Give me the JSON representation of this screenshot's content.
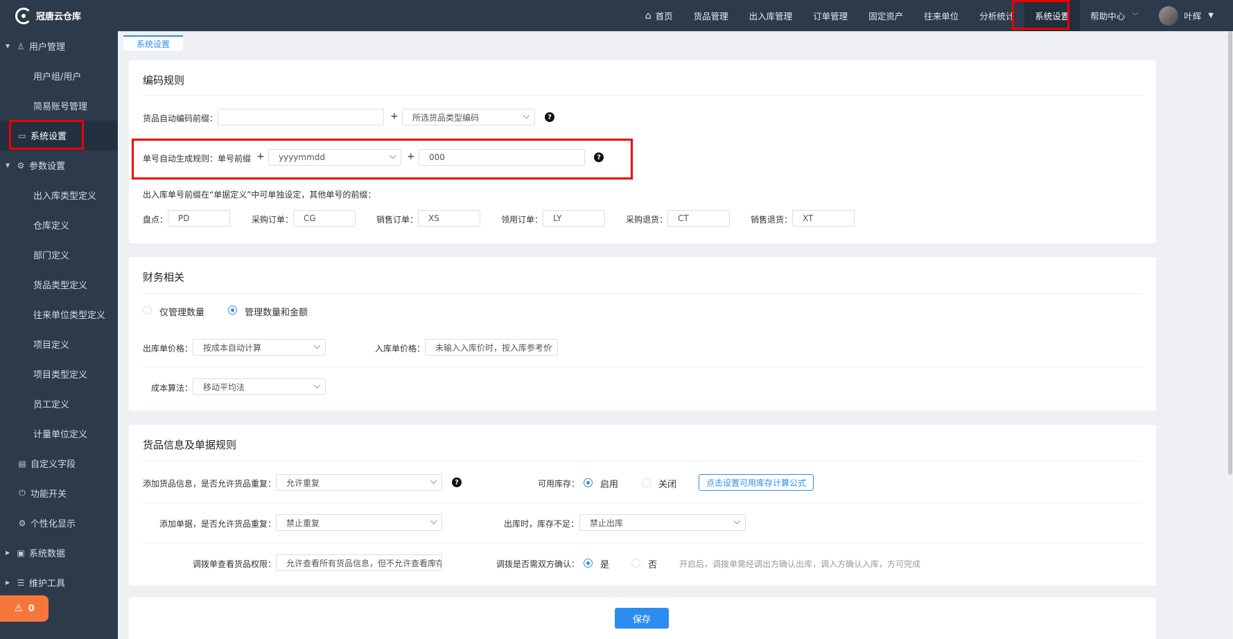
{
  "app": {
    "logo_text": "冠唐云仓库"
  },
  "sidebar": {
    "items": [
      {
        "label": "用户管理",
        "kind": "group",
        "icon": "user-icon"
      },
      {
        "label": "用户组/用户",
        "kind": "sub"
      },
      {
        "label": "简易账号管理",
        "kind": "sub"
      },
      {
        "label": "系统设置",
        "kind": "top",
        "icon": "monitor-icon",
        "active": true
      },
      {
        "label": "参数设置",
        "kind": "group",
        "icon": "gear-icon"
      },
      {
        "label": "出入库类型定义",
        "kind": "sub"
      },
      {
        "label": "仓库定义",
        "kind": "sub"
      },
      {
        "label": "部门定义",
        "kind": "sub"
      },
      {
        "label": "货品类型定义",
        "kind": "sub"
      },
      {
        "label": "往来单位类型定义",
        "kind": "sub"
      },
      {
        "label": "项目定义",
        "kind": "sub"
      },
      {
        "label": "项目类型定义",
        "kind": "sub"
      },
      {
        "label": "员工定义",
        "kind": "sub"
      },
      {
        "label": "计量单位定义",
        "kind": "sub"
      },
      {
        "label": "自定义字段",
        "kind": "top",
        "icon": "form-icon"
      },
      {
        "label": "功能开关",
        "kind": "top",
        "icon": "power-icon"
      },
      {
        "label": "个性化显示",
        "kind": "top",
        "icon": "gear-icon"
      },
      {
        "label": "系统数据",
        "kind": "group",
        "icon": "archive-icon"
      },
      {
        "label": "维护工具",
        "kind": "group",
        "icon": "database-icon"
      }
    ],
    "alert_count": "0"
  },
  "topnav": {
    "items": [
      "首页",
      "货品管理",
      "出入库管理",
      "订单管理",
      "固定资产",
      "往来单位",
      "分析统计",
      "系统设置",
      "帮助中心"
    ],
    "user_name": "叶辉"
  },
  "tab": {
    "label": "系统设置"
  },
  "coding": {
    "title": "编码规则",
    "goods_prefix_label": "货品自动编码前缀：",
    "goods_prefix_value": "",
    "goods_type_select": "所选货品类型编码",
    "order_rule_label": "单号自动生成规则：单号前缀",
    "date_format": "yyyymmdd",
    "serial": "000",
    "prefix_note": "出入库单号前缀在“单据定义”中可单独设定，其他单号的前缀：",
    "prefixes": [
      {
        "label": "盘点：",
        "value": "PD"
      },
      {
        "label": "采购订单：",
        "value": "CG"
      },
      {
        "label": "销售订单：",
        "value": "XS"
      },
      {
        "label": "领用订单：",
        "value": "LY"
      },
      {
        "label": "采购退货：",
        "value": "CT"
      },
      {
        "label": "销售退货：",
        "value": "XT"
      }
    ]
  },
  "finance": {
    "title": "财务相关",
    "radio_qty_only": "仅管理数量",
    "radio_qty_amount": "管理数量和金额",
    "out_price_label": "出库单价格：",
    "out_price_value": "按成本自动计算",
    "in_price_label": "入库单价格：",
    "in_price_value": "未输入入库价时，按入库参考价",
    "cost_label": "成本算法：",
    "cost_value": "移动平均法"
  },
  "goods_rules": {
    "title": "货品信息及单据规则",
    "dup_goods_label": "添加货品信息，是否允许货品重复：",
    "dup_goods_value": "允许重复",
    "stock_label": "可用库存：",
    "stock_on": "启用",
    "stock_off": "关闭",
    "stock_formula_btn": "点击设置可用库存计算公式",
    "dup_doc_label": "添加单据，是否允许货品重复：",
    "dup_doc_value": "禁止重复",
    "shortage_label": "出库时，库存不足：",
    "shortage_value": "禁止出库",
    "transfer_view_label": "调拨单查看货品权限：",
    "transfer_view_value": "允许查看所有货品信息，但不允许查看库存",
    "transfer_confirm_label": "调拨是否需双方确认：",
    "yes": "是",
    "no": "否",
    "transfer_hint": "开启后，调拨单需经调出方确认出库，调入方确认入库，方可完成"
  },
  "save_label": "保存"
}
